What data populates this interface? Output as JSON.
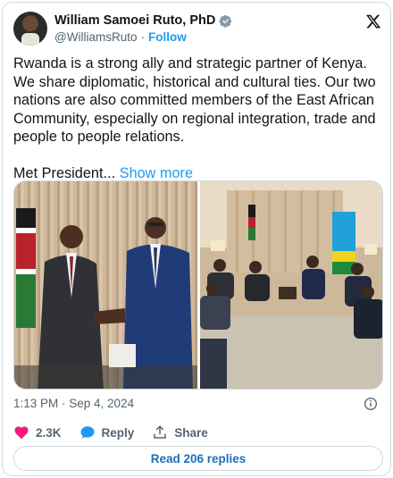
{
  "author": {
    "display_name": "William Samoei Ruto, PhD",
    "handle": "@WilliamsRuto",
    "separator": "·",
    "follow_label": "Follow"
  },
  "tweet": {
    "paragraph_1": "Rwanda is a strong ally and strategic partner of Kenya. We share diplomatic, historical and cultural ties. Our two nations are also  committed members of the East African Community, especially on regional integration, trade and people to people relations.",
    "paragraph_2_text": "Met President... ",
    "show_more_label": "Show more"
  },
  "meta": {
    "timestamp": "1:13 PM · Sep 4, 2024"
  },
  "actions": {
    "like_count": "2.3K",
    "reply_label": "Reply",
    "share_label": "Share"
  },
  "read_replies_label": "Read 206 replies",
  "colors": {
    "accent_blue": "#1d9bf0",
    "like_pink": "#f91880",
    "text_primary": "#0f1419",
    "text_secondary": "#536471",
    "border": "#cfd9de"
  },
  "icons": {
    "verified": "verified-badge-icon",
    "platform": "x-logo-icon",
    "info": "info-icon",
    "like": "heart-icon",
    "reply": "speech-bubble-icon",
    "share": "share-icon"
  }
}
